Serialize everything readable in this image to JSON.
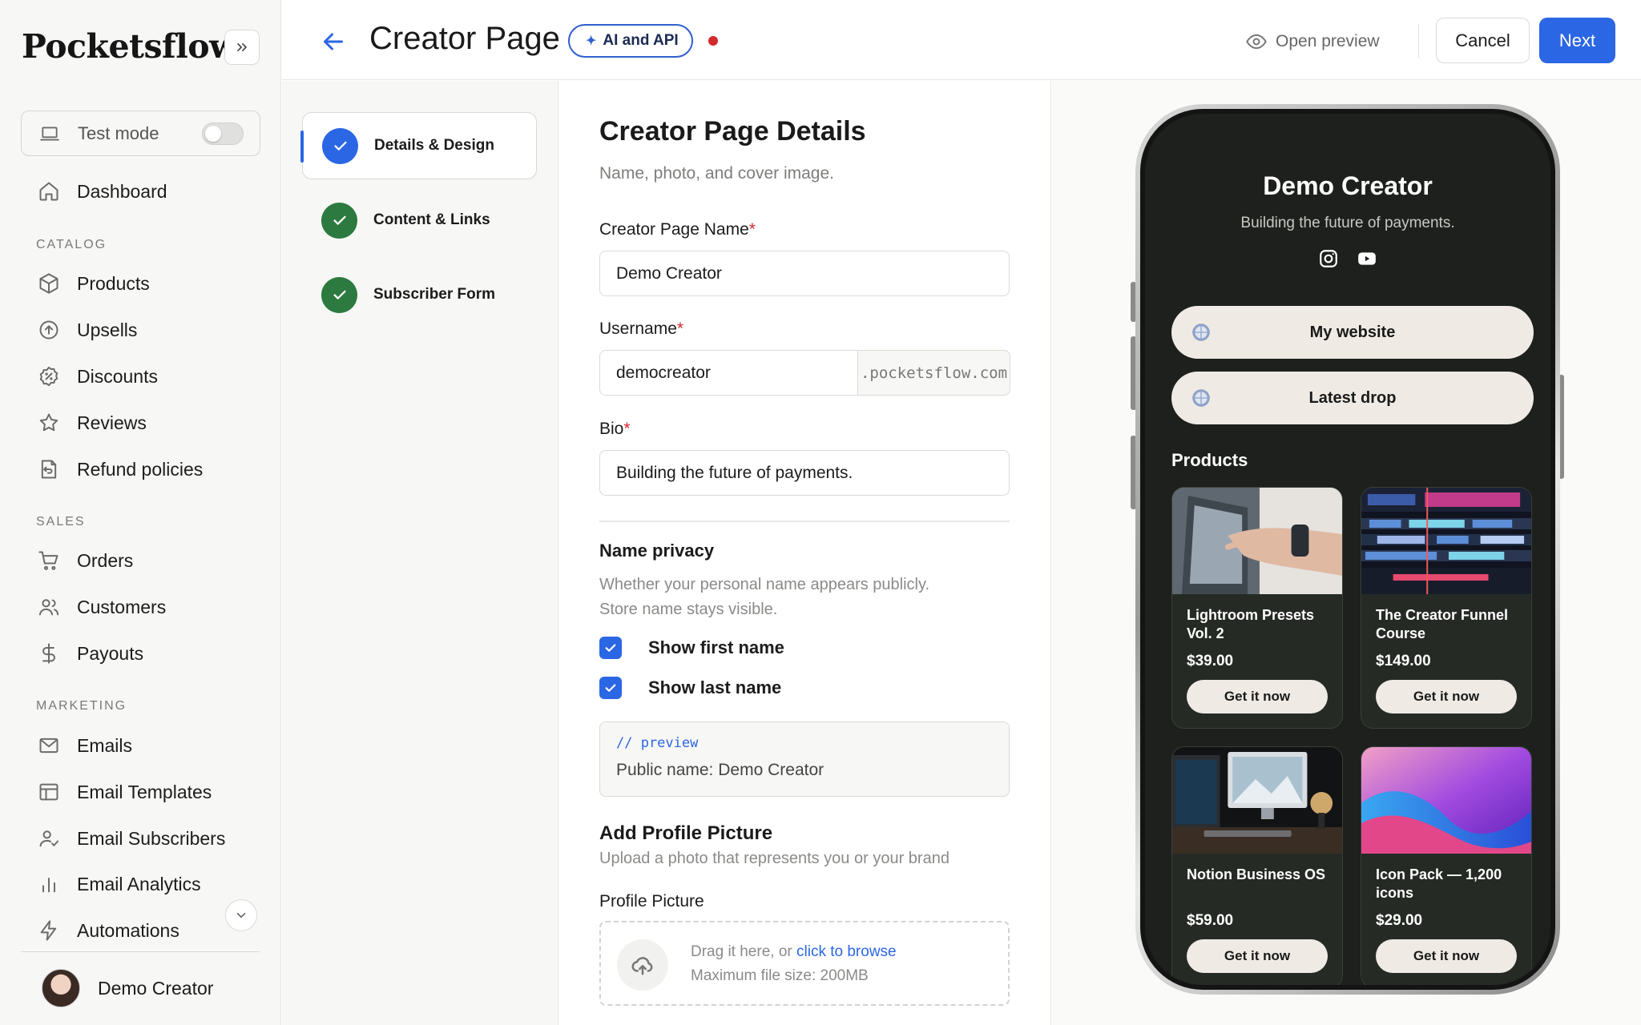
{
  "brand": {
    "logo_text": "Pocketsflow"
  },
  "sidebar": {
    "test_mode_label": "Test mode",
    "test_mode_on": false,
    "dashboard": "Dashboard",
    "sections": {
      "catalog": "CATALOG",
      "sales": "SALES",
      "marketing": "MARKETING"
    },
    "catalog_items": [
      "Products",
      "Upsells",
      "Discounts",
      "Reviews",
      "Refund policies"
    ],
    "sales_items": [
      "Orders",
      "Customers",
      "Payouts"
    ],
    "marketing_items": [
      "Emails",
      "Email Templates",
      "Email Subscribers",
      "Email Analytics",
      "Automations"
    ],
    "user_name": "Demo Creator"
  },
  "header": {
    "title": "Creator Page",
    "chip_label": "AI and API",
    "open_preview": "Open preview",
    "cancel": "Cancel",
    "next": "Next"
  },
  "steps": [
    {
      "label": "Details & Design",
      "state": "active"
    },
    {
      "label": "Content & Links",
      "state": "done"
    },
    {
      "label": "Subscriber Form",
      "state": "done"
    }
  ],
  "form": {
    "title": "Creator Page Details",
    "subtitle": "Name, photo, and cover image.",
    "name_label": "Creator Page Name",
    "name_value": "Demo Creator",
    "username_label": "Username",
    "username_value": "democreator",
    "username_suffix": ".pocketsflow.com",
    "bio_label": "Bio",
    "bio_value": "Building the future of payments.",
    "required_mark": "*",
    "privacy_title": "Name privacy",
    "privacy_desc_1": "Whether your personal name appears publicly.",
    "privacy_desc_2": "Store name stays visible.",
    "show_first": "Show first name",
    "show_last": "Show last name",
    "show_first_checked": true,
    "show_last_checked": true,
    "preview_code": "// preview",
    "preview_label": "Public name:",
    "preview_value": "Demo Creator",
    "profile_title": "Add Profile Picture",
    "profile_desc": "Upload a photo that represents you or your brand",
    "profile_label": "Profile Picture",
    "drop_text": "Drag it here, or",
    "drop_link": "click to browse",
    "drop_limit": "Maximum file size: 200MB"
  },
  "phone": {
    "name": "Demo Creator",
    "bio": "Building the future of payments.",
    "links": [
      "My website",
      "Latest drop"
    ],
    "products_heading": "Products",
    "products": [
      {
        "name": "Lightroom Presets Vol. 2",
        "price": "$39.00",
        "cta": "Get it now",
        "image": "laptop-hand-photo"
      },
      {
        "name": "The Creator Funnel Course",
        "price": "$149.00",
        "cta": "Get it now",
        "image": "video-editing-timeline"
      },
      {
        "name": "Notion Business OS",
        "price": "$59.00",
        "cta": "Get it now",
        "image": "desk-monitor-setup"
      },
      {
        "name": "Icon Pack — 1,200 icons",
        "price": "$29.00",
        "cta": "Get it now",
        "image": "purple-gradient-waves"
      }
    ]
  },
  "colors": {
    "accent": "#2b66e4",
    "success": "#2c7a3f",
    "required": "#d2292d",
    "phone_bg": "#1d201c",
    "link_pill": "#efebe4"
  }
}
